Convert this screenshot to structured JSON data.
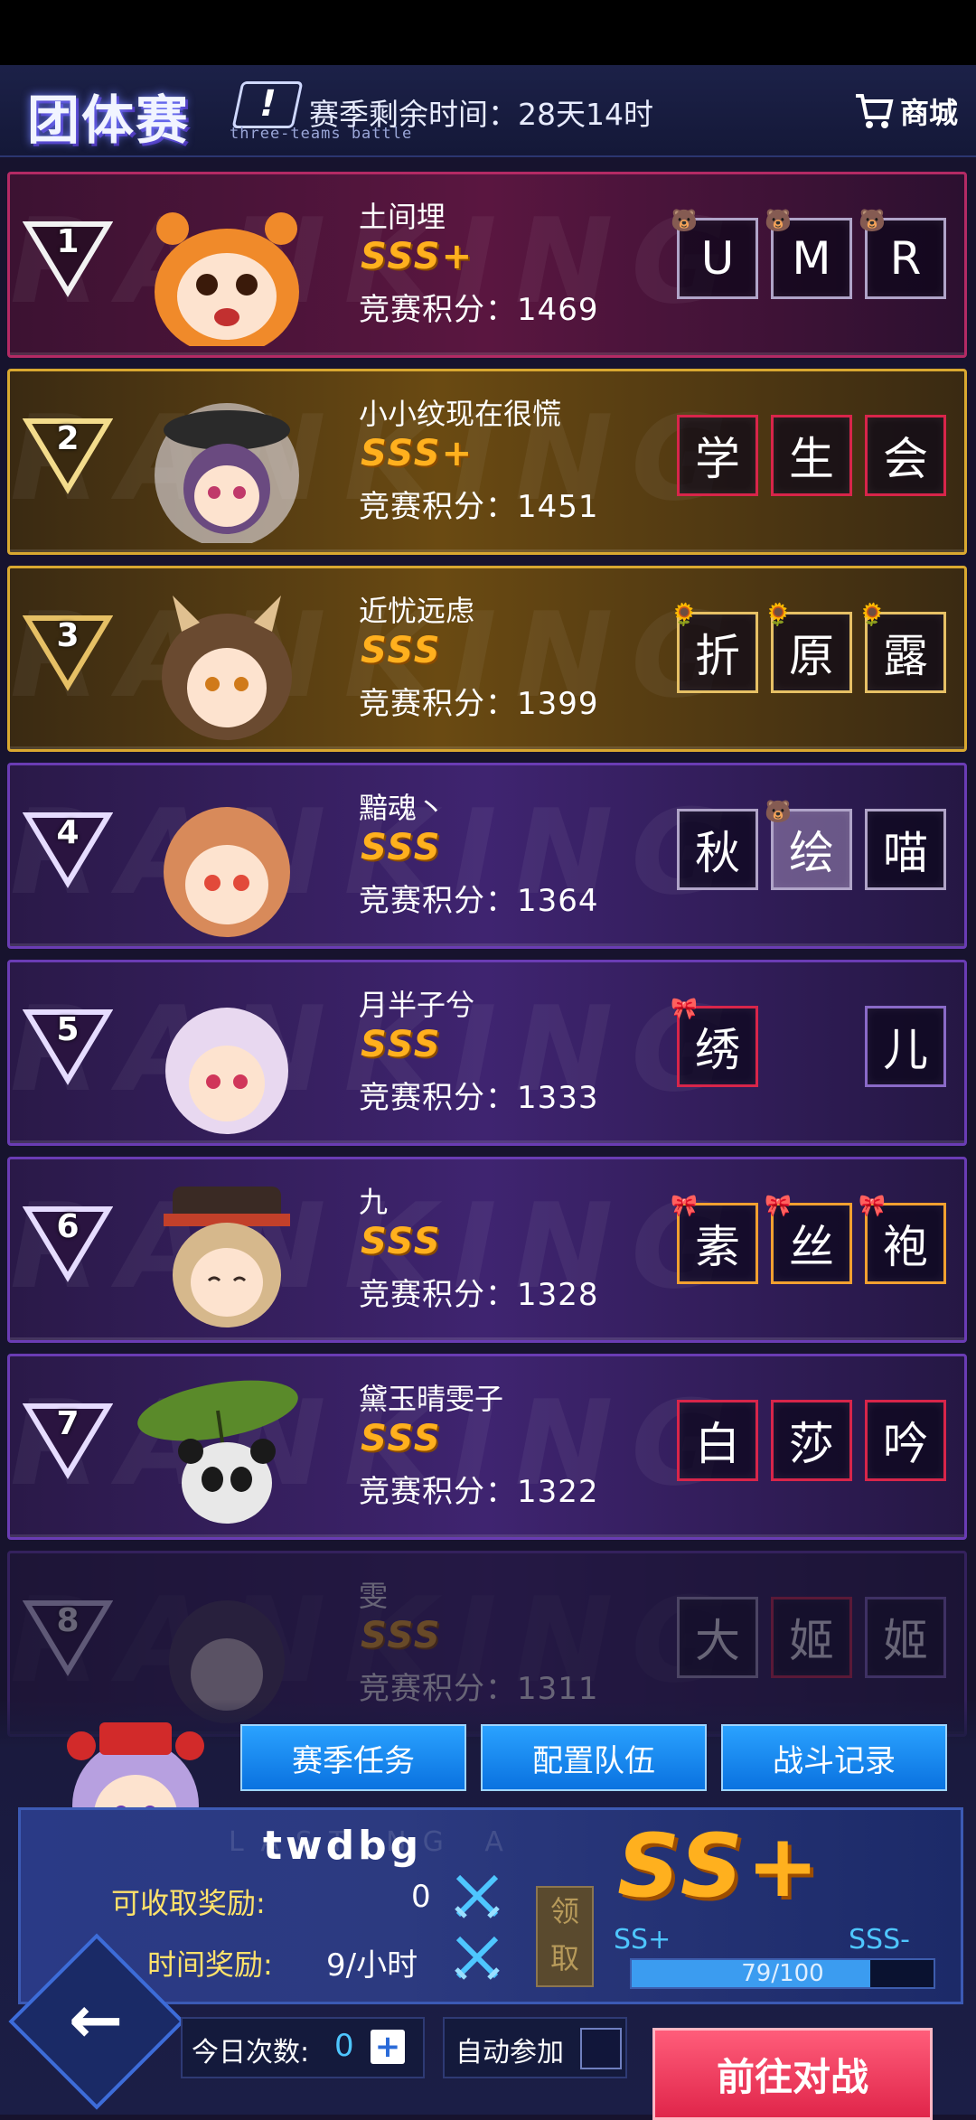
{
  "header": {
    "title": "团体赛",
    "subtitle": "three-teams battle",
    "season_time": "赛季剩余时间：28天14时",
    "shop_label": "商城"
  },
  "watermark": "RANKING",
  "rows": [
    {
      "rank": "1",
      "name": "土间埋",
      "grade": "SSS+",
      "score": "竞赛积分：1469",
      "team": [
        "U",
        "M",
        "R"
      ]
    },
    {
      "rank": "2",
      "name": "小小纹现在很慌",
      "grade": "SSS+",
      "score": "竞赛积分：1451",
      "team": [
        "学",
        "生",
        "会"
      ]
    },
    {
      "rank": "3",
      "name": "近忧远虑",
      "grade": "SSS",
      "score": "竞赛积分：1399",
      "team": [
        "折",
        "原",
        "露"
      ]
    },
    {
      "rank": "4",
      "name": "黯魂丶",
      "grade": "SSS",
      "score": "竞赛积分：1364",
      "team": [
        "秋",
        "绘",
        "喵"
      ]
    },
    {
      "rank": "5",
      "name": "月半子兮",
      "grade": "SSS",
      "score": "竞赛积分：1333",
      "team": [
        "绣",
        "",
        "儿"
      ]
    },
    {
      "rank": "6",
      "name": "九",
      "grade": "SSS",
      "score": "竞赛积分：1328",
      "team": [
        "素",
        "丝",
        "袍"
      ]
    },
    {
      "rank": "7",
      "name": "黛玉晴雯子",
      "grade": "SSS",
      "score": "竞赛积分：1322",
      "team": [
        "白",
        "莎",
        "吟"
      ]
    },
    {
      "rank": "8",
      "name": "雯",
      "grade": "SSS",
      "score": "竞赛积分：1311",
      "team": [
        "大",
        "姬",
        "姬"
      ]
    }
  ],
  "tabs": {
    "season_tasks": "赛季任务",
    "configure_team": "配置队伍",
    "battle_records": "战斗记录"
  },
  "player": {
    "username": "twdbg",
    "bg_text": "LASTING A",
    "claimable_label": "可收取奖励:",
    "claimable_value": "0",
    "time_reward_label": "时间奖励:",
    "time_reward_value": "9/小时",
    "claim_button": "领取",
    "grade": "SS+",
    "tier_left": "SS+",
    "tier_right": "SSS-",
    "progress_text": "79/100",
    "progress_fraction": 0.79
  },
  "footer": {
    "today_label": "今日次数:",
    "today_count": "0",
    "plus": "+",
    "auto_join_label": "自动参加",
    "battle_button": "前往对战",
    "back_arrow": "←"
  }
}
